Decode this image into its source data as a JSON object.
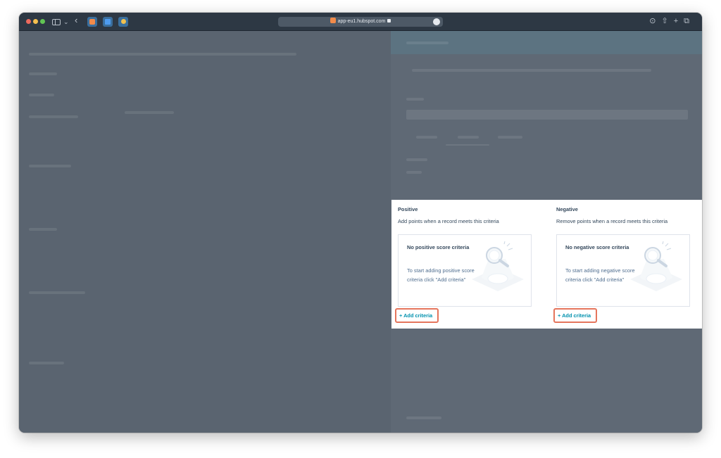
{
  "browser": {
    "url": "app-eu1.hubspot.com",
    "icons": [
      "traffic-lights",
      "sidebar-icon",
      "chevron-down-icon",
      "back-icon",
      "extension-icon",
      "share-icon",
      "new-tab-icon",
      "tabs-icon"
    ]
  },
  "criteria": {
    "positive": {
      "title": "Positive",
      "description": "Add points when a record meets this criteria",
      "empty_title": "No positive score criteria",
      "empty_body": "To start adding positive score criteria click \"Add criteria\"",
      "add_label": "+ Add criteria"
    },
    "negative": {
      "title": "Negative",
      "description": "Remove points when a record meets this criteria",
      "empty_title": "No negative score criteria",
      "empty_body": "To start adding negative score criteria click \"Add criteria\"",
      "add_label": "+ Add criteria"
    }
  },
  "colors": {
    "overlay": "#5a6470",
    "panel_header": "#5c7381",
    "text_dark": "#33475b",
    "link": "#0091ae",
    "highlight": "#e5755c"
  }
}
